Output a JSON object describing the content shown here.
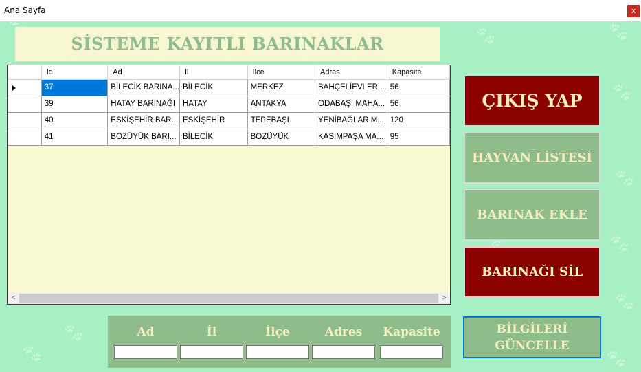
{
  "window": {
    "title": "Ana Sayfa",
    "close_label": "x"
  },
  "heading": "SİSTEME KAYITLI BARINAKLAR",
  "grid": {
    "columns": [
      "Id",
      "Ad",
      "Il",
      "Ilce",
      "Adres",
      "Kapasite"
    ],
    "rows": [
      [
        "37",
        "BİLECİK BARINA...",
        "BİLECİK",
        "MERKEZ",
        "BAHÇELİEVLER ...",
        "56"
      ],
      [
        "39",
        "HATAY BARINAĞI",
        "HATAY",
        "ANTAKYA",
        "ODABAŞI MAHA...",
        "56"
      ],
      [
        "40",
        "ESKİŞEHİR BAR...",
        "ESKİŞEHİR",
        "TEPEBAŞI",
        "YENİBAĞLAR M...",
        "120"
      ],
      [
        "41",
        "BOZÜYÜK BARI...",
        "BİLECİK",
        "BOZÜYÜK",
        "KASIMPAŞA MA...",
        "95"
      ]
    ],
    "selected_row": 0,
    "scroll_left_glyph": "<",
    "scroll_right_glyph": ">"
  },
  "buttons": {
    "logout": "ÇIKIŞ YAP",
    "animal_list": "HAYVAN LİSTESİ",
    "add_shelter": "BARINAK EKLE",
    "delete_shelter": "BARINAĞI SİL",
    "update_info_line1": "BİLGİLERİ",
    "update_info_line2": "GÜNCELLE"
  },
  "form": {
    "labels": {
      "ad": "Ad",
      "il": "İl",
      "ilce": "İlçe",
      "adres": "Adres",
      "kapasite": "Kapasite"
    },
    "values": {
      "ad": "",
      "il": "",
      "ilce": "",
      "adres": "",
      "kapasite": ""
    }
  },
  "colors": {
    "background": "#a6f0c4",
    "heading_bg": "#f6f6d3",
    "heading_text": "#8fbc8b",
    "button_dark": "#8b0000",
    "button_green": "#8fbc8b",
    "button_text": "#f5efc0",
    "selection": "#0078d7"
  },
  "icons": {
    "paw": "paw-print-icon",
    "row_indicator": "row-indicator-arrow-icon"
  }
}
